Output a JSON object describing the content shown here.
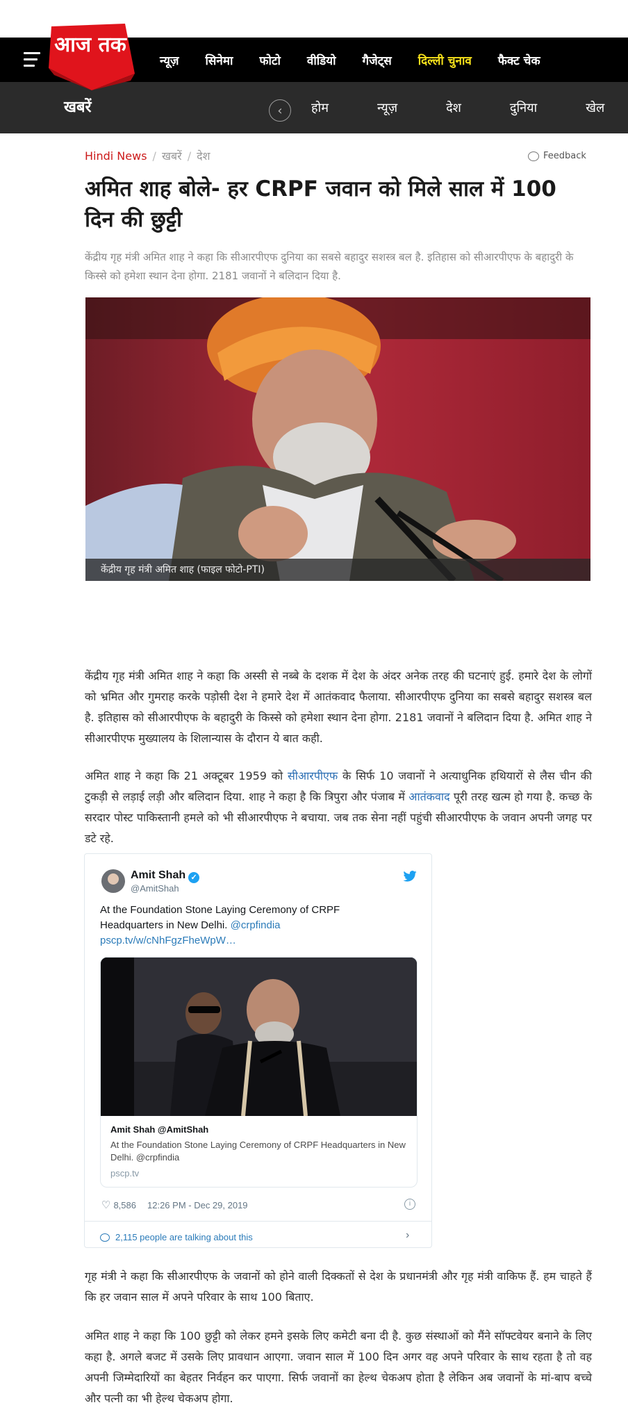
{
  "site": {
    "logo_text": "आज तक",
    "top_nav": [
      "न्यूज़",
      "सिनेमा",
      "फोटो",
      "वीडियो",
      "गैजेट्स",
      "दिल्ली चुनाव",
      "फैक्ट चेक"
    ],
    "highlight_item": "दिल्ली चुनाव",
    "section_name": "खबरें",
    "sub_nav": [
      "होम",
      "न्यूज़",
      "देश",
      "दुनिया",
      "खेल"
    ],
    "colors": {
      "brand_red": "#e0141c",
      "highlight": "#f7e11b",
      "link": "#2c6fb4"
    }
  },
  "breadcrumb": {
    "home": "Hindi News",
    "level2": "खबरें",
    "level3": "देश"
  },
  "feedback_label": "Feedback",
  "article": {
    "headline": "अमित शाह बोले- हर CRPF जवान को मिले साल में 100 दिन की छुट्टी",
    "summary": "केंद्रीय गृह मंत्री अमित शाह ने कहा कि सीआरपीएफ दुनिया का सबसे बहादुर सशस्त्र बल है. इतिहास को सीआरपीएफ के बहादुरी के किस्से को हमेशा स्थान देना होगा. 2181 जवानों ने बलिदान दिया है.",
    "image_caption": "केंद्रीय गृह मंत्री अमित शाह (फाइल फोटो-PTI)",
    "p1": "केंद्रीय गृह मंत्री अमित शाह ने कहा कि अस्सी से नब्बे के दशक में देश के अंदर अनेक तरह की घटनाएं हुई. हमारे देश के लोगों को भ्रमित और गुमराह करके पड़ोसी देश ने हमारे देश में आतंकवाद फैलाया. सीआरपीएफ दुनिया का सबसे बहादुर सशस्त्र बल है. इतिहास को सीआरपीएफ के बहादुरी के किस्से को हमेशा स्थान देना होगा. 2181 जवानों ने बलिदान दिया है. अमित शाह ने सीआरपीएफ मुख्यालय के शिलान्यास के दौरान ये बात कही.",
    "p2_a": "अमित शाह ने कहा कि 21 अक्टूबर 1959 को ",
    "p2_link1": "सीआरपीएफ",
    "p2_b": " के सिर्फ 10 जवानों ने अत्याधुनिक हथियारों से लैस चीन की टुकड़ी से लड़ाई लड़ी और बलिदान दिया. शाह ने कहा है कि त्रिपुरा और पंजाब में ",
    "p2_link2": "आतंकवाद",
    "p2_c": " पूरी तरह खत्म हो गया है. कच्छ के सरदार पोस्ट पाकिस्तानी हमले को भी सीआरपीएफ ने बचाया. जब तक सेना नहीं पहुंची सीआरपीएफ के जवान अपनी जगह पर डटे रहे.",
    "p3": "गृह मंत्री ने कहा कि सीआरपीएफ के जवानों को होने वाली दिक्कतों से देश के प्रधानमंत्री और गृह मंत्री वाकिफ हैं. हम चाहते हैं कि हर जवान साल में अपने परिवार के साथ 100 बिताए.",
    "p4": "अमित शाह ने कहा कि 100 छुट्टी को लेकर हमने इसके लिए कमेटी बना दी है. कुछ संस्थाओं को मैंने सॉफ्टवेयर बनाने के लिए कहा है. अगले बजट में उसके लिए प्रावधान आएगा. जवान साल में 100 दिन अगर वह अपने परिवार के साथ रहता है तो वह अपनी जिम्मेदारियों का बेहतर निर्वहन कर पाएगा. सिर्फ जवानों का हेल्थ चेकअप होता है लेकिन अब जवानों के मां-बाप बच्चे और पत्नी का भी हेल्थ चेकअप होगा."
  },
  "tweet": {
    "name": "Amit Shah",
    "handle": "@AmitShah",
    "text": "At the Foundation Stone Laying Ceremony of CRPF Headquarters in New Delhi. ",
    "mention": "@crpfindia",
    "link": "pscp.tv/w/cNhFgzFheWpW…",
    "card_title": "Amit Shah @AmitShah",
    "card_desc": "At the Foundation Stone Laying Ceremony of CRPF Headquarters in New Delhi. @crpfindia",
    "card_domain": "pscp.tv",
    "likes": "8,586",
    "timestamp": "12:26 PM - Dec 29, 2019",
    "talking": "2,115 people are talking about this"
  }
}
